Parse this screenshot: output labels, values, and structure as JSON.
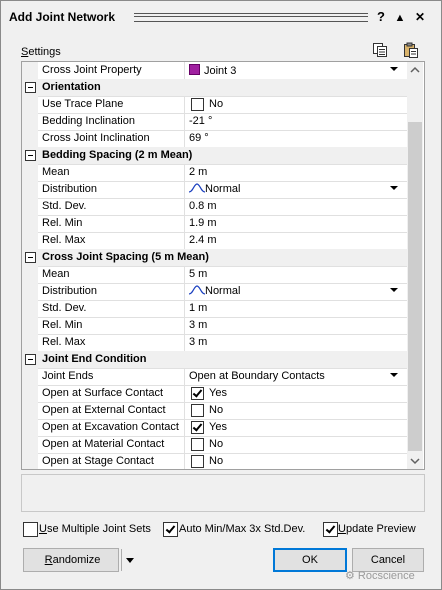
{
  "window": {
    "title": "Add Joint Network",
    "help": "?",
    "collapse": "▲",
    "close": "✕"
  },
  "settings_label": "Settings",
  "grid": {
    "rows": [
      {
        "kind": "prop",
        "name": "Cross Joint Property",
        "value": "Joint 3",
        "type": "swatch-dropdown",
        "color": "#a020a0"
      },
      {
        "kind": "cat",
        "name": "Orientation"
      },
      {
        "kind": "prop",
        "name": "Use Trace Plane",
        "value": "No",
        "type": "checkbox",
        "checked": false
      },
      {
        "kind": "prop",
        "name": "Bedding Inclination",
        "value": "-21 °",
        "type": "text"
      },
      {
        "kind": "prop",
        "name": "Cross Joint Inclination",
        "value": "69 °",
        "type": "text"
      },
      {
        "kind": "cat",
        "name": "Bedding Spacing   (2 m  Mean)"
      },
      {
        "kind": "prop",
        "name": "Mean",
        "value": "2 m",
        "type": "text"
      },
      {
        "kind": "prop",
        "name": "Distribution",
        "value": "Normal",
        "type": "dist-dropdown"
      },
      {
        "kind": "prop",
        "name": "Std. Dev.",
        "value": "0.8 m",
        "type": "text"
      },
      {
        "kind": "prop",
        "name": "Rel. Min",
        "value": "1.9 m",
        "type": "text"
      },
      {
        "kind": "prop",
        "name": "Rel. Max",
        "value": "2.4 m",
        "type": "text"
      },
      {
        "kind": "cat",
        "name": "Cross Joint Spacing   (5 m  Mean)"
      },
      {
        "kind": "prop",
        "name": "Mean",
        "value": "5 m",
        "type": "text"
      },
      {
        "kind": "prop",
        "name": "Distribution",
        "value": "Normal",
        "type": "dist-dropdown"
      },
      {
        "kind": "prop",
        "name": "Std. Dev.",
        "value": "1 m",
        "type": "text"
      },
      {
        "kind": "prop",
        "name": "Rel. Min",
        "value": "3 m",
        "type": "text"
      },
      {
        "kind": "prop",
        "name": "Rel. Max",
        "value": "3 m",
        "type": "text"
      },
      {
        "kind": "cat",
        "name": "Joint End Condition"
      },
      {
        "kind": "prop",
        "name": "Joint Ends",
        "value": "Open at Boundary Contacts",
        "type": "dropdown"
      },
      {
        "kind": "prop",
        "name": "Open at Surface Contact",
        "value": "Yes",
        "type": "checkbox",
        "checked": true
      },
      {
        "kind": "prop",
        "name": "Open at External Contact",
        "value": "No",
        "type": "checkbox",
        "checked": false
      },
      {
        "kind": "prop",
        "name": "Open at Excavation Contact",
        "value": "Yes",
        "type": "checkbox",
        "checked": true
      },
      {
        "kind": "prop",
        "name": "Open at Material Contact",
        "value": "No",
        "type": "checkbox",
        "checked": false
      },
      {
        "kind": "prop",
        "name": "Open at Stage Contact",
        "value": "No",
        "type": "checkbox",
        "checked": false
      }
    ]
  },
  "options": {
    "use_multiple": {
      "label": "Use Multiple Joint Sets",
      "checked": false
    },
    "auto_minmax": {
      "label": "Auto Min/Max 3x Std.Dev.",
      "checked": true
    },
    "update_preview": {
      "label": "Update Preview",
      "checked": true
    }
  },
  "buttons": {
    "randomize": "Randomize",
    "ok": "OK",
    "cancel": "Cancel"
  },
  "watermark": "Rocscience"
}
